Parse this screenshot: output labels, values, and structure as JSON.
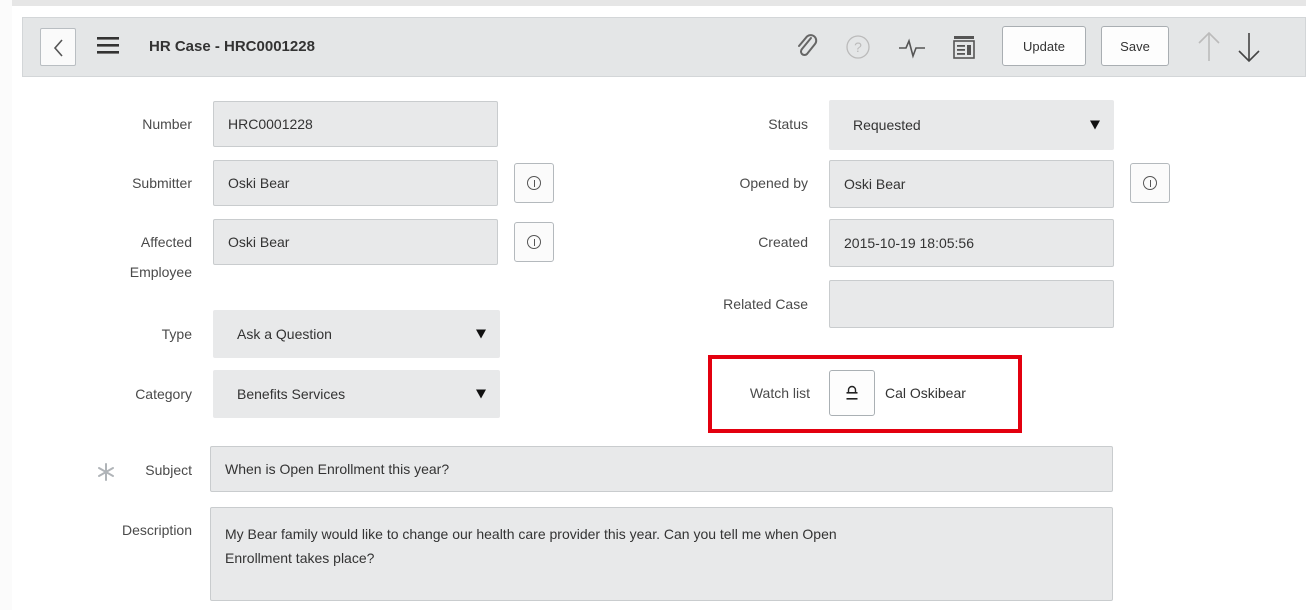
{
  "header": {
    "title": "HR Case - HRC0001228",
    "update_label": "Update",
    "save_label": "Save"
  },
  "form": {
    "number": {
      "label": "Number",
      "value": "HRC0001228"
    },
    "submitter": {
      "label": "Submitter",
      "value": "Oski Bear"
    },
    "affected_employee": {
      "label_line1": "Affected",
      "label_line2": "Employee",
      "value": "Oski Bear"
    },
    "type": {
      "label": "Type",
      "value": "Ask a Question"
    },
    "category": {
      "label": "Category",
      "value": "Benefits Services"
    },
    "status": {
      "label": "Status",
      "value": "Requested"
    },
    "opened_by": {
      "label": "Opened by",
      "value": "Oski Bear"
    },
    "created": {
      "label": "Created",
      "value": "2015-10-19 18:05:56"
    },
    "related_case": {
      "label": "Related Case",
      "value": ""
    },
    "watch_list": {
      "label": "Watch list",
      "value": "Cal Oskibear"
    },
    "subject": {
      "label": "Subject",
      "value": "When is Open Enrollment this year?"
    },
    "description": {
      "label": "Description",
      "line1": "My Bear family would like to change our health care provider this year.  Can you tell me when Open",
      "line2": "Enrollment takes place?"
    }
  },
  "icons": [
    "back-icon",
    "menu-icon",
    "paperclip-icon",
    "help-icon",
    "activity-icon",
    "context-menu-icon",
    "info-icon",
    "lock-icon",
    "arrow-up-icon",
    "arrow-down-icon",
    "required-asterisk-icon"
  ],
  "colors": {
    "highlight": "#e3000f",
    "header_bg": "#e4e6e7",
    "field_bg": "#e8e9ea"
  }
}
